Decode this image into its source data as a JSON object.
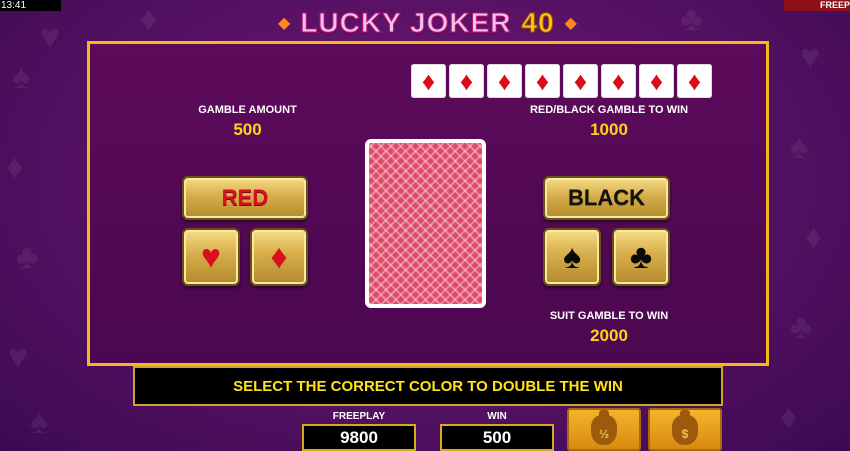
{
  "status": {
    "clock": "13:41",
    "mode_tab": "FREEPL"
  },
  "logo": {
    "title": "LUCKY JOKER",
    "number": "40"
  },
  "history": {
    "suit_icon": "diamond-icon",
    "cards": [
      "♦",
      "♦",
      "♦",
      "♦",
      "♦",
      "♦",
      "♦",
      "♦"
    ]
  },
  "gamble_amount": {
    "label": "GAMBLE AMOUNT",
    "value": "500"
  },
  "red_black_win": {
    "label": "RED/BLACK GAMBLE TO WIN",
    "value": "1000"
  },
  "suit_win": {
    "label": "SUIT GAMBLE TO WIN",
    "value": "2000"
  },
  "buttons": {
    "red": "RED",
    "black": "BLACK",
    "hearts": "♥",
    "diamonds": "♦",
    "spades": "♠",
    "clubs": "♣"
  },
  "message": "SELECT THE CORRECT COLOR TO DOUBLE THE WIN",
  "footer": {
    "freeplay_label": "FREEPLAY",
    "freeplay_value": "9800",
    "win_label": "WIN",
    "win_value": "500",
    "collect_half_label": "½",
    "collect_all_label": "$"
  },
  "colors": {
    "gold": "#f2b81c",
    "red_suit": "#d80c1a",
    "message_text": "#ffe21a",
    "panel_bg": "#4b0850"
  }
}
